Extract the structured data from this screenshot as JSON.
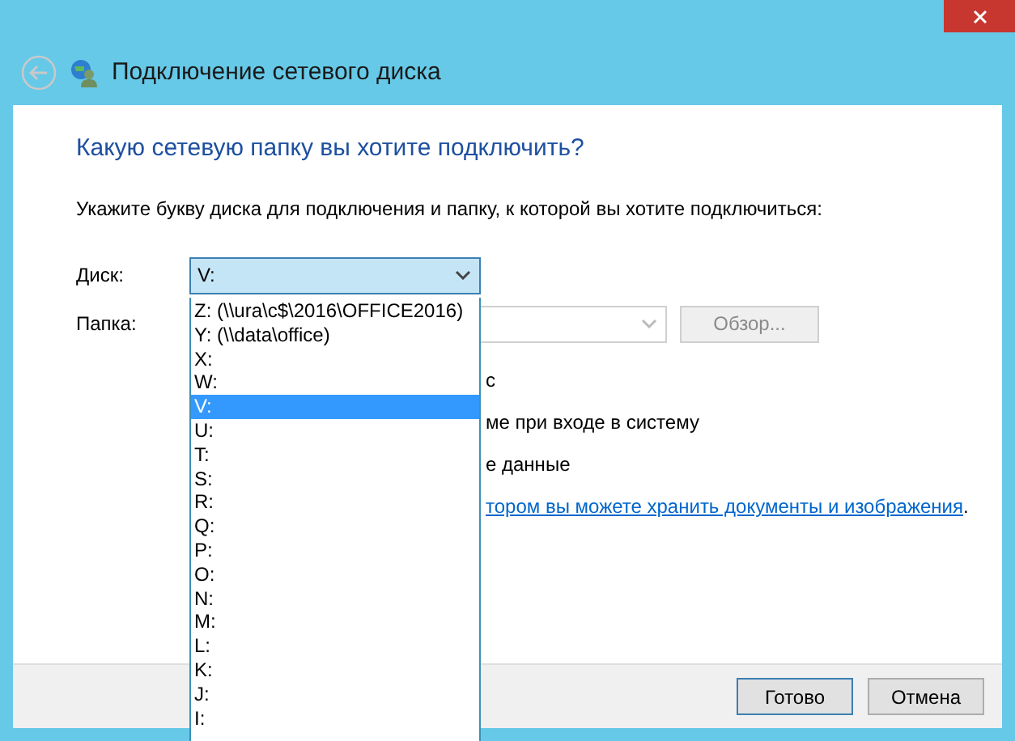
{
  "window": {
    "title": "Подключение сетевого диска"
  },
  "heading": "Какую сетевую папку вы хотите подключить?",
  "instruction": "Укажите букву диска для подключения и папку, к которой вы хотите подключиться:",
  "drive": {
    "label": "Диск:",
    "value": "V:",
    "expanded": true
  },
  "folder": {
    "label": "Папка:",
    "disabled": true,
    "browse_button": "Обзор..."
  },
  "options_visible_text": [
    {
      "kind": "text",
      "text": "с"
    },
    {
      "kind": "text",
      "text": "ме при входе в систему"
    },
    {
      "kind": "text",
      "text": "е данные"
    },
    {
      "kind": "link",
      "text": "тором вы можете хранить документы и изображения",
      "after": "."
    }
  ],
  "drive_list": [
    {
      "label": "Z: (\\\\ura\\c$\\2016\\OFFICE2016)",
      "selected": false
    },
    {
      "label": "Y: (\\\\data\\office)",
      "selected": false
    },
    {
      "label": "X:",
      "selected": false
    },
    {
      "label": "W:",
      "selected": false
    },
    {
      "label": "V:",
      "selected": true
    },
    {
      "label": "U:",
      "selected": false
    },
    {
      "label": "T:",
      "selected": false
    },
    {
      "label": "S:",
      "selected": false
    },
    {
      "label": "R:",
      "selected": false
    },
    {
      "label": "Q:",
      "selected": false
    },
    {
      "label": "P:",
      "selected": false
    },
    {
      "label": "O:",
      "selected": false
    },
    {
      "label": "N:",
      "selected": false
    },
    {
      "label": "M:",
      "selected": false
    },
    {
      "label": "L:",
      "selected": false
    },
    {
      "label": "K:",
      "selected": false
    },
    {
      "label": "J:",
      "selected": false
    },
    {
      "label": "I:",
      "selected": false
    }
  ],
  "buttons": [
    {
      "label": "Готово",
      "default": true
    },
    {
      "label": "Отмена",
      "default": false
    }
  ]
}
